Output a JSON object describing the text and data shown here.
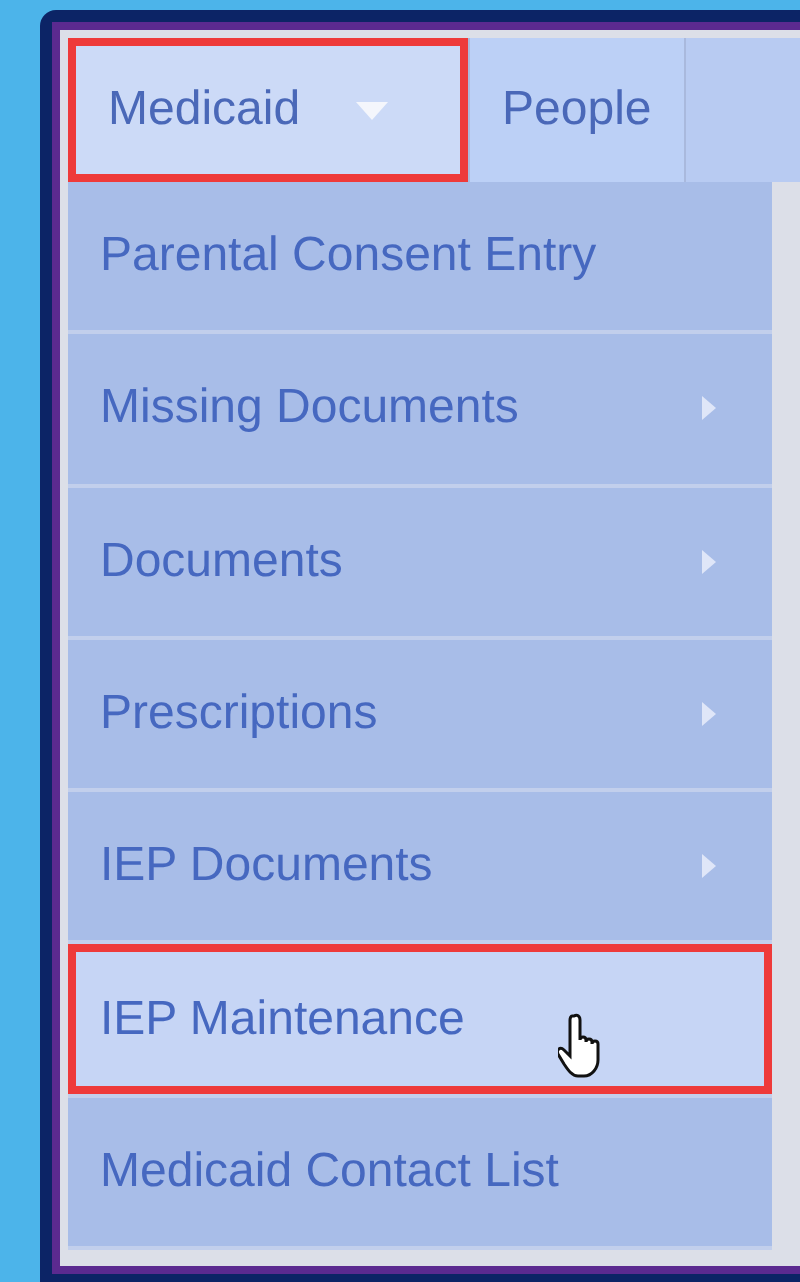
{
  "tabs": [
    {
      "label": "Medicaid",
      "selected": true,
      "outlined": true,
      "has_dropdown": true
    },
    {
      "label": "People",
      "selected": false,
      "outlined": false,
      "has_dropdown": false
    }
  ],
  "menu_items": [
    {
      "label": "Parental Consent Entry",
      "has_submenu": false,
      "selected": false,
      "outlined": false
    },
    {
      "label": "Missing Documents",
      "has_submenu": true,
      "selected": false,
      "outlined": false
    },
    {
      "label": "Documents",
      "has_submenu": true,
      "selected": false,
      "outlined": false
    },
    {
      "label": "Prescriptions",
      "has_submenu": true,
      "selected": false,
      "outlined": false
    },
    {
      "label": "IEP Documents",
      "has_submenu": true,
      "selected": false,
      "outlined": false
    },
    {
      "label": "IEP Maintenance",
      "has_submenu": false,
      "selected": true,
      "outlined": true
    },
    {
      "label": "Medicaid Contact List",
      "has_submenu": false,
      "selected": false,
      "outlined": false
    }
  ]
}
